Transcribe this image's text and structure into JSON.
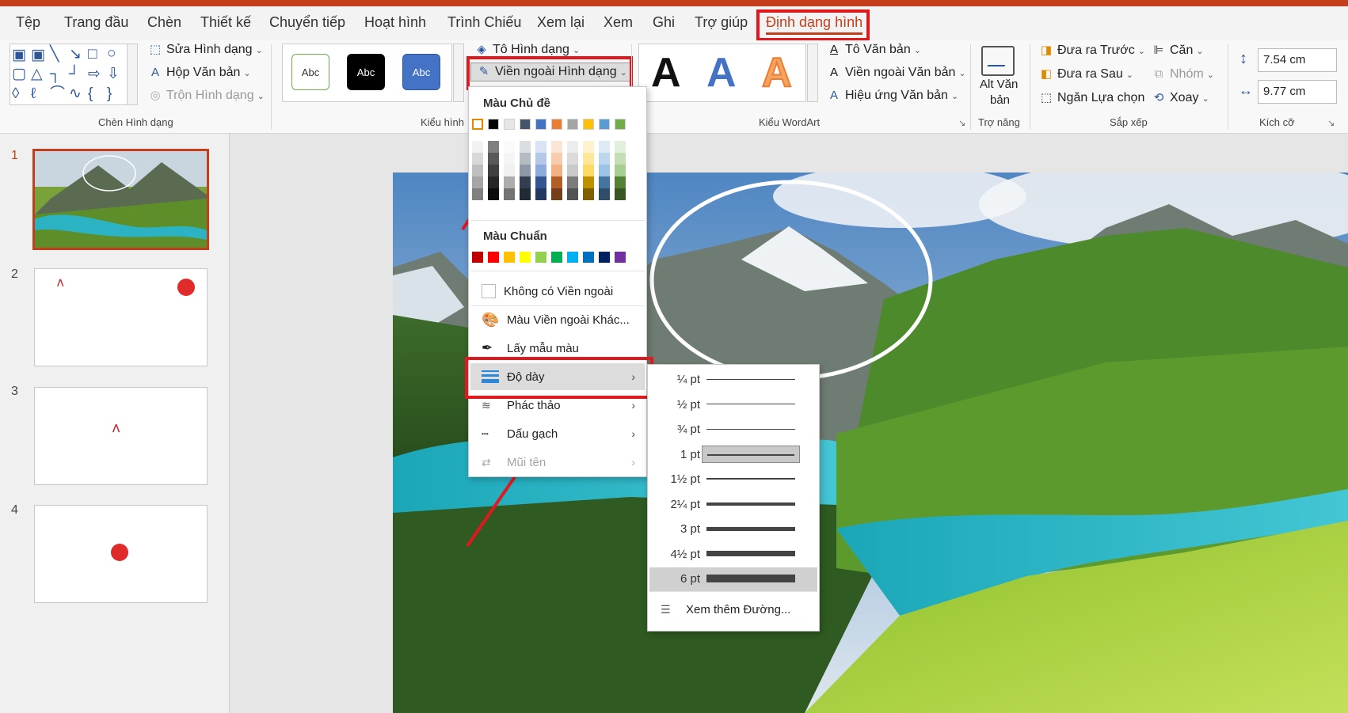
{
  "tabs": [
    "Tệp",
    "Trang đầu",
    "Chèn",
    "Thiết kế",
    "Chuyển tiếp",
    "Hoạt hình",
    "Trình Chiếu",
    "Xem lại",
    "Xem",
    "Ghi",
    "Trợ giúp",
    "Định dạng hình"
  ],
  "ribbon": {
    "insert_shapes": {
      "edit_shape": "Sửa Hình dạng",
      "text_box": "Hộp Văn bản",
      "merge_shapes": "Trộn Hình dạng",
      "group_label": "Chèn Hình dạng"
    },
    "shape_styles": {
      "style_sample": "Abc",
      "fill": "Tô Hình dạng",
      "outline": "Viền ngoài Hình dạng",
      "group_label": "Kiểu hình"
    },
    "wordart": {
      "letter": "A",
      "text_fill": "Tô Văn bản",
      "text_outline": "Viền ngoài Văn bản",
      "text_effects": "Hiệu ứng Văn bản",
      "group_label": "Kiểu WordArt"
    },
    "accessibility": {
      "alt_text_line1": "Alt Văn",
      "alt_text_line2": "bản",
      "group_label": "Trợ năng"
    },
    "arrange": {
      "bring_forward": "Đưa ra Trước",
      "send_backward": "Đưa ra Sau",
      "selection_pane": "Ngăn Lựa chọn",
      "align": "Căn",
      "group": "Nhóm",
      "rotate": "Xoay",
      "group_label": "Sắp xếp"
    },
    "size": {
      "height": "7.54 cm",
      "width": "9.77 cm",
      "group_label": "Kích cỡ"
    }
  },
  "slides": [
    {
      "number": "1",
      "selected": true
    },
    {
      "number": "2",
      "selected": false
    },
    {
      "number": "3",
      "selected": false
    },
    {
      "number": "4",
      "selected": false
    }
  ],
  "outline_menu": {
    "theme_colors_title": "Màu Chủ đề",
    "standard_colors_title": "Màu Chuẩn",
    "no_outline": "Không có Viền ngoài",
    "more_colors": "Màu Viền ngoài Khác...",
    "eyedropper": "Lấy mẫu màu",
    "weight": "Độ dày",
    "sketched": "Phác thảo",
    "dashes": "Dấu gạch",
    "arrows": "Mũi tên",
    "theme_top": [
      "#ffffff",
      "#000000",
      "#e7e6e6",
      "#44546a",
      "#4472c4",
      "#ed7d31",
      "#a5a5a5",
      "#ffc000",
      "#5b9bd5",
      "#70ad47"
    ],
    "standard": [
      "#c00000",
      "#ff0000",
      "#ffc000",
      "#ffff00",
      "#92d050",
      "#00b050",
      "#00b0f0",
      "#0070c0",
      "#002060",
      "#7030a0"
    ]
  },
  "weight_menu": {
    "items": [
      "¼ pt",
      "½ pt",
      "¾ pt",
      "1 pt",
      "1½ pt",
      "2¼ pt",
      "3 pt",
      "4½ pt",
      "6 pt"
    ],
    "weights_pt": [
      0.25,
      0.5,
      0.75,
      1,
      1.5,
      2.25,
      3,
      4.5,
      6
    ],
    "current": "1 pt",
    "hovered": "6 pt",
    "more_lines": "Xem thêm Đường..."
  }
}
